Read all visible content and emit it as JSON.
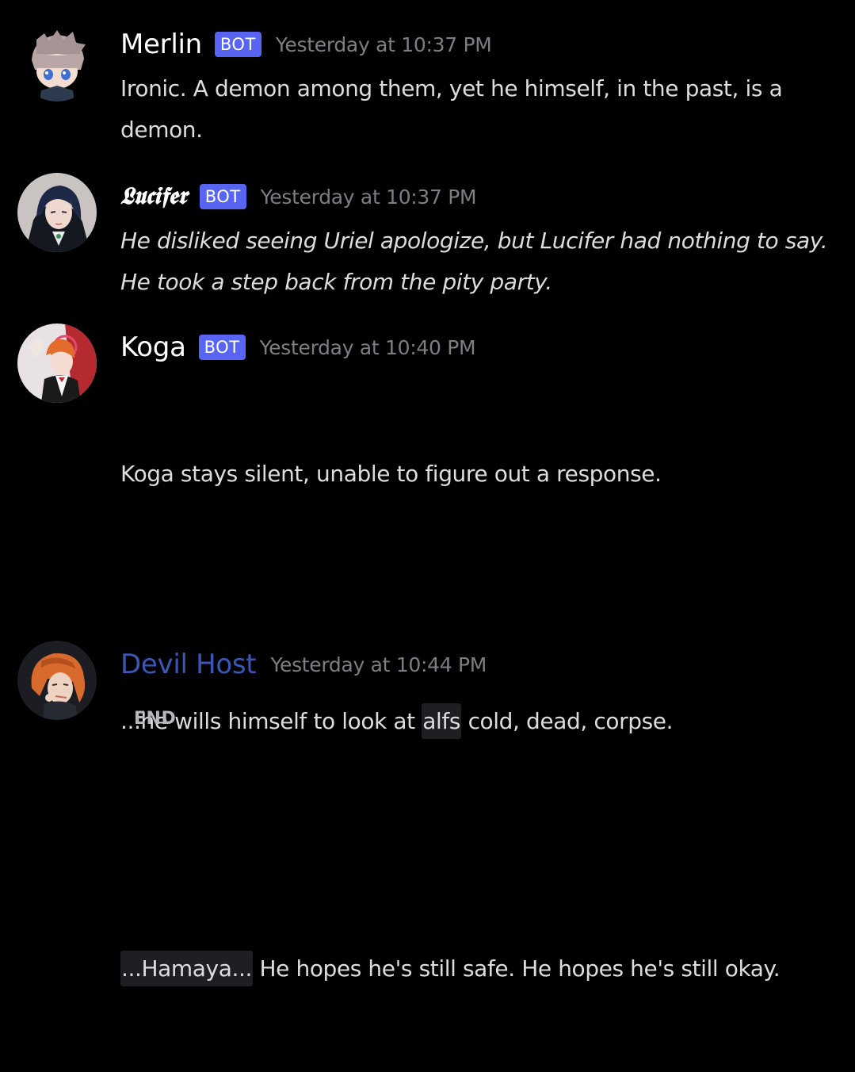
{
  "messages": [
    {
      "author": "Merlin",
      "tag": "BOT",
      "timestamp": "Yesterday at 10:37 PM",
      "text": "Ironic. A demon among them, yet he himself, in the past, is a demon."
    },
    {
      "author": "𝕷𝖚𝖈𝖎𝖋𝖊𝖗",
      "tag": "BOT",
      "timestamp": "Yesterday at 10:37 PM",
      "text": "He disliked seeing Uriel apologize, but Lucifer had nothing to say. He took a step back from the pity party."
    },
    {
      "author": "Koga",
      "tag": "BOT",
      "timestamp": "Yesterday at 10:40 PM",
      "line1": "Koga stays silent, unable to figure out a response.",
      "line2_pre": "...he wills himself to look at ",
      "line2_highlight": "alfs",
      "line2_post": " cold, dead, corpse.",
      "line3_highlight": "...Hamaya...",
      "line3_post": " He hopes he's still safe. He hopes he's still okay."
    },
    {
      "author": "Devil Host",
      "timestamp": "Yesterday at 10:44 PM",
      "text": "END"
    }
  ],
  "colors": {
    "background": "#000000",
    "bot_tag": "#5865f2",
    "host_name": "#3b57b5",
    "text": "#dcddde",
    "timestamp": "#7c7e84"
  },
  "icons": [
    "merlin-avatar",
    "lucifer-avatar",
    "koga-avatar",
    "devil-host-avatar"
  ]
}
